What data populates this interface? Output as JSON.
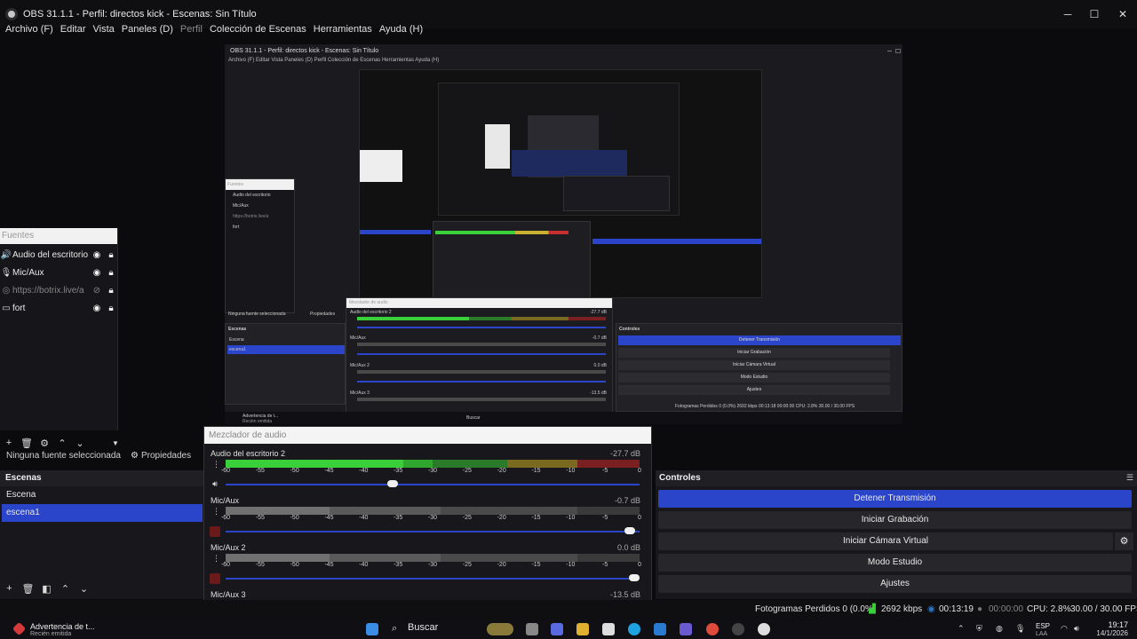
{
  "window": {
    "title": "OBS 31.1.1 - Perfil: directos kick - Escenas: Sin Título",
    "minimize": "─",
    "maximize": "☐",
    "close": "✕"
  },
  "menu": [
    {
      "label": "Archivo (F)"
    },
    {
      "label": "Editar"
    },
    {
      "label": "Vista"
    },
    {
      "label": "Paneles (D)"
    },
    {
      "label": "Perfil",
      "dim": true
    },
    {
      "label": "Colección de Escenas"
    },
    {
      "label": "Herramientas"
    },
    {
      "label": "Ayuda (H)"
    }
  ],
  "preview": {
    "inner_title": "OBS 31.1.1 - Perfil: directos kick - Escenas: Sin Título",
    "inner_menu": "Archivo (F)   Editar   Vista   Paneles (D)   Perfil   Colección de Escenas   Herramientas   Ayuda (H)",
    "inner_mixer_label": "Mezclador de audio",
    "inner_ch1": "Audio del escritorio 2",
    "inner_ch1_db": "-27.7 dB",
    "inner_ch2": "Mic/Aux",
    "inner_ch2_db": "-0.7 dB",
    "inner_ch3": "Mic/Aux 2",
    "inner_ch3_db": "0.0 dB",
    "inner_ch4": "Mic/Aux 3",
    "inner_ch4_db": "-13.5 dB",
    "inner_controls": "Controles",
    "inner_btn1": "Detener Transmisión",
    "inner_btn2": "Iniciar Grabación",
    "inner_btn3": "Iniciar Cámara Virtual",
    "inner_btn4": "Modo Estudio",
    "inner_btn5": "Ajustes",
    "inner_scenes": "Escenas",
    "inner_scene1": "Escena",
    "inner_scene2": "escena1",
    "inner_fuentes": "Fuentes",
    "inner_ninguna": "Ninguna fuente seleccionada",
    "inner_props": "Propiedades",
    "inner_status": "Fotogramas Perdidos 0 (0.0%)   2692 kbps   00:13:18   00:00:00   CPU: 2.8%   30.00 / 30.00 FPS",
    "inner_search": "Buscar",
    "inner_warning": "Advertencia de t...",
    "inner_warning_sub": "Recién emitida",
    "inner_src1": "Audio del escritorio",
    "inner_src2": "Mic/Aux",
    "inner_src3": "https://botrix.live/a",
    "inner_src4": "fort"
  },
  "sources": {
    "header": "Fuentes",
    "items": [
      {
        "icon": "speaker-icon",
        "glyph": "🔊",
        "label": "Audio del escritorio",
        "dim": false
      },
      {
        "icon": "mic-icon",
        "glyph": "🎙",
        "label": "Mic/Aux",
        "dim": false
      },
      {
        "icon": "globe-icon",
        "glyph": "◎",
        "label": "https://botrix.live/a",
        "dim": true
      },
      {
        "icon": "window-icon",
        "glyph": "▭",
        "label": "fort",
        "dim": false
      }
    ],
    "no_selection": "Ninguna fuente seleccionada",
    "properties": "Propiedades"
  },
  "scenes": {
    "header": "Escenas",
    "items": [
      {
        "label": "Escena",
        "selected": false
      },
      {
        "label": "escena1",
        "selected": true
      }
    ]
  },
  "mixer": {
    "header": "Mezclador de audio",
    "ticks": [
      "-60",
      "-55",
      "-50",
      "-45",
      "-40",
      "-35",
      "-30",
      "-25",
      "-20",
      "-15",
      "-10",
      "-5",
      "0"
    ],
    "channels": [
      {
        "name": "Audio del escritorio 2",
        "db": "-27.7 dB",
        "level_fraction": 0.5,
        "volume_fraction": 0.4,
        "muted": false,
        "active": true
      },
      {
        "name": "Mic/Aux",
        "db": "-0.7 dB",
        "level_fraction": 0.01,
        "volume_fraction": 0.99,
        "muted": true,
        "active": false
      },
      {
        "name": "Mic/Aux 2",
        "db": "0.0 dB",
        "level_fraction": 0.01,
        "volume_fraction": 1.0,
        "muted": true,
        "active": false
      },
      {
        "name": "Mic/Aux 3",
        "db": "-13.5 dB",
        "level_fraction": 0.01,
        "volume_fraction": 0.7,
        "muted": true,
        "active": false
      }
    ]
  },
  "controls": {
    "header": "Controles",
    "buttons": [
      {
        "label": "Detener Transmisión",
        "primary": true
      },
      {
        "label": "Iniciar Grabación",
        "primary": false
      },
      {
        "label": "Iniciar Cámara Virtual",
        "primary": false
      },
      {
        "label": "Modo Estudio",
        "primary": false
      },
      {
        "label": "Ajustes",
        "primary": false
      }
    ]
  },
  "status": {
    "dropped_frames": "Fotogramas Perdidos 0 (0.0%)",
    "bitrate": "2692 kbps",
    "stream_time": "00:13:19",
    "rec_time": "00:00:00",
    "cpu": "CPU: 2.8%",
    "fps": "30.00 / 30.00 FPS"
  },
  "taskbar": {
    "notification_title": "Advertencia de t...",
    "notification_sub": "Recién emitida",
    "search": "Buscar",
    "lang": "ESP",
    "lang_sub": "LAA",
    "time": "19:17",
    "date": "14/1/2026"
  },
  "colors": {
    "accent": "#2a45c9",
    "meter_green": "#39d039",
    "meter_yellow": "#c8b030",
    "meter_red": "#c83030"
  }
}
